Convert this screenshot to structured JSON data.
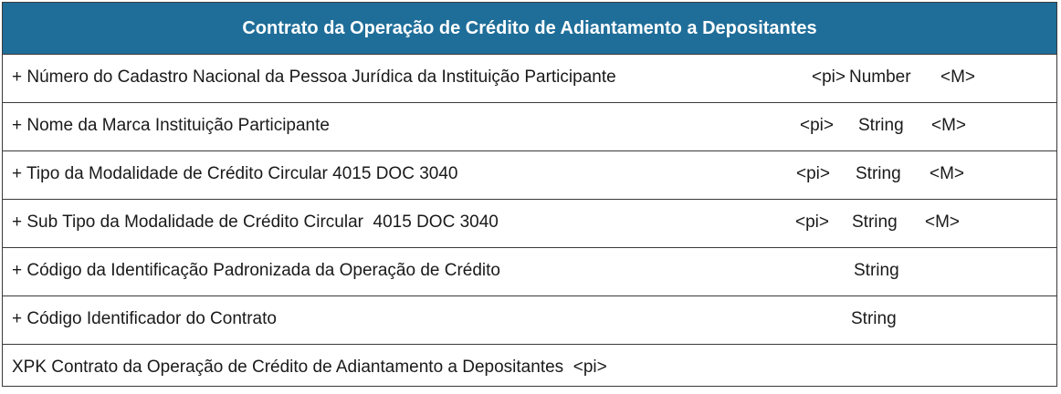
{
  "entity": {
    "title": "Contrato da Operação de Crédito de Adiantamento a Depositantes",
    "header_color": "#1f6e99",
    "attributes": [
      {
        "name": "+ Número do Cadastro Nacional da Pessoa Jurídica da Instituição Participante",
        "key": "<pi>",
        "type": "Number",
        "mandatory": "<M>"
      },
      {
        "name": "+ Nome da Marca Instituição Participante",
        "key": "<pi>",
        "type": "String",
        "mandatory": "<M>"
      },
      {
        "name": "+ Tipo da Modalidade de Crédito Circular 4015 DOC 3040",
        "key": "<pi>",
        "type": "String",
        "mandatory": "<M>"
      },
      {
        "name": "+ Sub Tipo da Modalidade de Crédito Circular  4015 DOC 3040",
        "key": "<pi>",
        "type": "String",
        "mandatory": "<M>"
      },
      {
        "name": "+ Código da Identificação Padronizada da Operação de Crédito",
        "type": "String"
      },
      {
        "name": "+ Código Identificador do Contrato",
        "type": "String"
      }
    ],
    "identifier": "XPK Contrato da Operação de Crédito de Adiantamento a Depositantes  <pi>"
  }
}
